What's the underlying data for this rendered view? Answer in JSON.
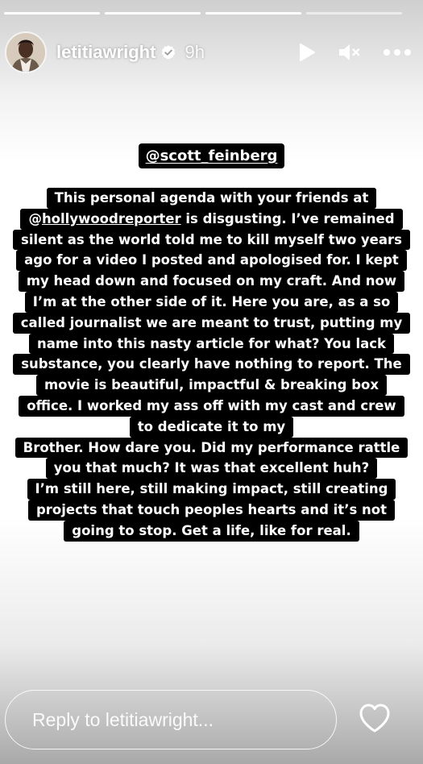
{
  "progress": {
    "segments": 4,
    "completed": 3
  },
  "header": {
    "username": "letitiawright",
    "verified": true,
    "time": "9h"
  },
  "story": {
    "tag": "@scott_feinberg",
    "lines": [
      [
        "This personal agenda with your friends at"
      ],
      [
        "@",
        {
          "u": "hollywoodreporter"
        },
        " is disgusting. I’ve remained"
      ],
      [
        "silent as the world told me to kill myself two years"
      ],
      [
        "ago for a video I posted and apologised for. I kept"
      ],
      [
        "my head down and focused on my craft. And now"
      ],
      [
        "I’m at the other side of it. Here you are, as a so"
      ],
      [
        "called journalist we are meant to trust, putting my"
      ],
      [
        "name into this nasty article for what? You lack"
      ],
      [
        "substance, you clearly have nothing to report. The"
      ],
      [
        "movie is beautiful, impactful & breaking box"
      ],
      [
        "office. I worked my ass off with my cast and crew"
      ],
      [
        "to dedicate it to my"
      ],
      [
        "Brother. How dare you. Did my performance rattle"
      ],
      [
        "you that much? It was that excellent huh?"
      ],
      [
        "I’m still here, still making impact, still creating"
      ],
      [
        "projects that touch peoples hearts and it’s not"
      ],
      [
        "going to stop. Get a life, like for real."
      ]
    ]
  },
  "reply": {
    "placeholder": "Reply to letitiawright..."
  },
  "colors": {
    "text_highlight": "#000000",
    "text": "#ffffff",
    "verified_badge": "#ffffff"
  },
  "icons": [
    "play-icon",
    "mute-icon",
    "more-icon",
    "heart-icon",
    "verified-icon"
  ]
}
